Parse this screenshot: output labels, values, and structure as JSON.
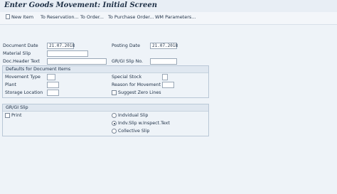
{
  "window": {
    "title": "Enter Goods Movement: Initial Screen"
  },
  "toolbar": {
    "new_item": "New Item",
    "to_reservation": "To Reservation...",
    "to_order": "To Order...",
    "to_purchase_order": "To Purchase Order...",
    "wm_parameters": "WM Parameters..."
  },
  "header": {
    "document_date_label": "Document Date",
    "document_date_value": "21.07.2018",
    "posting_date_label": "Posting Date",
    "posting_date_value": "21.07.2018",
    "material_slip_label": "Material Slip",
    "material_slip_value": "",
    "doc_header_text_label": "Doc.Header Text",
    "doc_header_text_value": "",
    "gr_gi_slip_no_label": "GR/GI Slip No.",
    "gr_gi_slip_no_value": ""
  },
  "defaults": {
    "title": "Defaults for Document Items",
    "movement_type_label": "Movement Type",
    "plant_label": "Plant",
    "storage_location_label": "Storage Location",
    "special_stock_label": "Special Stock",
    "reason_for_movement_label": "Reason for Movement",
    "suggest_zero_lines_label": "Suggest Zero Lines",
    "suggest_zero_lines_checked": false
  },
  "gr_gi_slip": {
    "title": "GR/GI Slip",
    "print_label": "Print",
    "print_checked": false,
    "options": [
      {
        "label": "Indvidual Slip",
        "selected": false
      },
      {
        "label": "Indv.Slip w.Inspect.Text",
        "selected": true
      },
      {
        "label": "Collective Slip",
        "selected": false
      }
    ]
  },
  "icons": {
    "new_item": "new-item-icon"
  }
}
